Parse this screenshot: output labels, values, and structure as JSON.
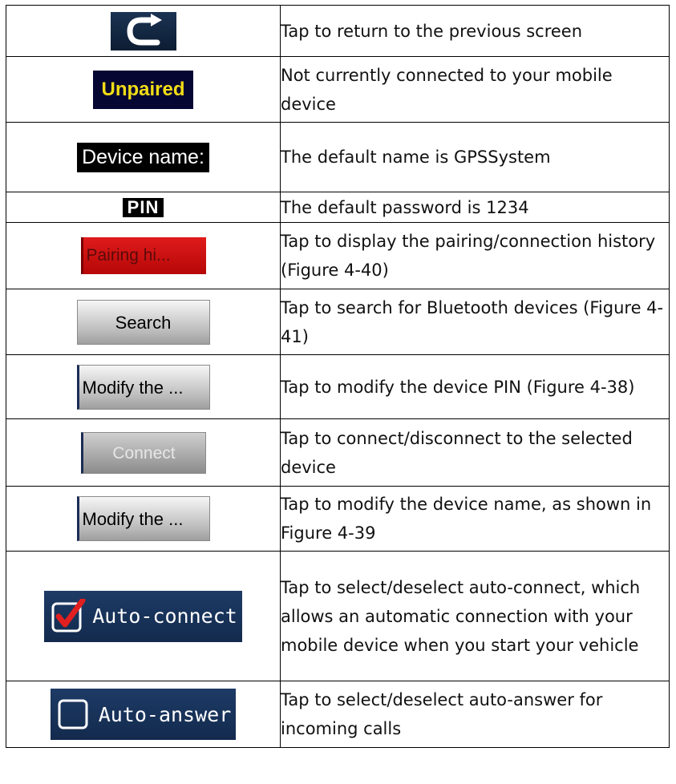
{
  "rows": [
    {
      "icon": "back-arrow-icon",
      "desc": "Tap to return to the previous screen"
    },
    {
      "icon_label": "Unpaired",
      "desc": "Not currently connected to your mobile device"
    },
    {
      "icon_label": "Device name:",
      "desc": "The default name is GPSSystem"
    },
    {
      "icon_label": "PIN",
      "desc": "The default password is 1234"
    },
    {
      "icon_label": "Pairing hi...",
      "desc": "Tap to display the pairing/connection history (Figure 4-40)"
    },
    {
      "icon_label": "Search",
      "desc": "Tap to search for Bluetooth devices (Figure 4-41)"
    },
    {
      "icon_label": "Modify the ...",
      "desc": "Tap to modify the device PIN (Figure 4-38)"
    },
    {
      "icon_label": "Connect",
      "desc": "Tap to connect/disconnect to the selected device"
    },
    {
      "icon_label": "Modify the ...",
      "desc": "Tap to modify the device name, as shown in Figure 4-39"
    },
    {
      "icon_label": "Auto-connect",
      "checked": true,
      "desc": "Tap to select/deselect auto-connect, which allows an automatic connection with your mobile device when you start your vehicle"
    },
    {
      "icon_label": "Auto-answer",
      "checked": false,
      "desc": "Tap to select/deselect auto-answer for incoming calls"
    }
  ],
  "colors": {
    "unpaired_text": "#f2dd16",
    "checkmark": "#e02020",
    "button_navy": "#132a4d"
  }
}
